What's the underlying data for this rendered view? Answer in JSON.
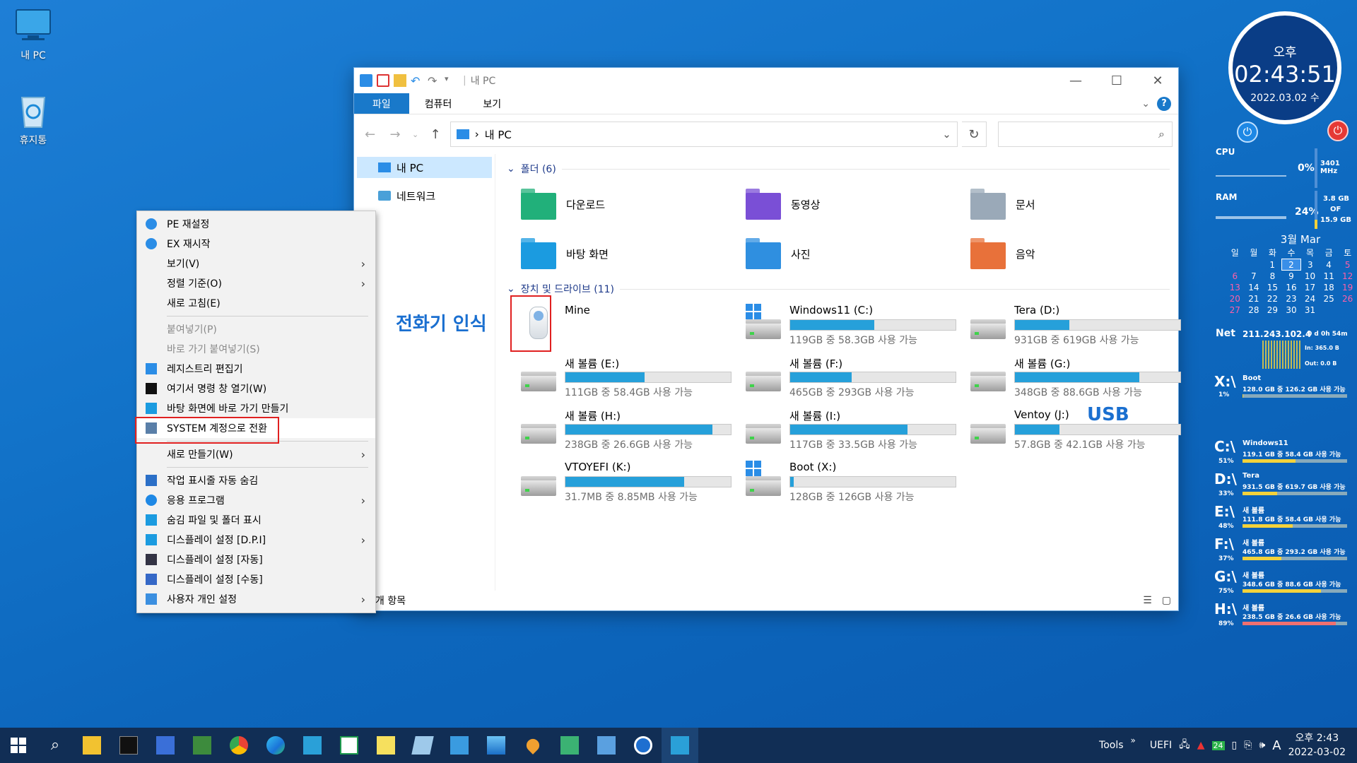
{
  "desktop": {
    "icons": [
      {
        "label": "내 PC"
      },
      {
        "label": "휴지통"
      }
    ]
  },
  "explorer": {
    "title": "내 PC",
    "ribbon_tabs": [
      "파일",
      "컴퓨터",
      "보기"
    ],
    "address": "내 PC",
    "nav": {
      "items": [
        "내 PC",
        "네트워크"
      ]
    },
    "folders_header": "폴더 (6)",
    "folders": [
      {
        "name": "다운로드",
        "icon": "downloads-folder-icon"
      },
      {
        "name": "동영상",
        "icon": "videos-folder-icon"
      },
      {
        "name": "문서",
        "icon": "documents-folder-icon"
      },
      {
        "name": "바탕 화면",
        "icon": "desktop-folder-icon"
      },
      {
        "name": "사진",
        "icon": "pictures-folder-icon"
      },
      {
        "name": "음악",
        "icon": "music-folder-icon"
      }
    ],
    "drives_header": "장치 및 드라이브 (11)",
    "drives": [
      {
        "name": "Mine",
        "type": "phone",
        "free": "",
        "used_fraction": 0
      },
      {
        "name": "Windows11 (C:)",
        "type": "win",
        "free": "119GB 중 58.3GB 사용 가능",
        "used_fraction": 0.51
      },
      {
        "name": "Tera (D:)",
        "type": "hdd",
        "free": "931GB 중 619GB 사용 가능",
        "used_fraction": 0.33
      },
      {
        "name": "새 볼륨 (E:)",
        "type": "hdd",
        "free": "111GB 중 58.4GB 사용 가능",
        "used_fraction": 0.48
      },
      {
        "name": "새 볼륨 (F:)",
        "type": "hdd",
        "free": "465GB 중 293GB 사용 가능",
        "used_fraction": 0.37
      },
      {
        "name": "새 볼륨 (G:)",
        "type": "hdd",
        "free": "348GB 중 88.6GB 사용 가능",
        "used_fraction": 0.75
      },
      {
        "name": "새 볼륨 (H:)",
        "type": "hdd",
        "free": "238GB 중 26.6GB 사용 가능",
        "used_fraction": 0.89
      },
      {
        "name": "새 볼륨 (I:)",
        "type": "hdd",
        "free": "117GB 중 33.5GB 사용 가능",
        "used_fraction": 0.71
      },
      {
        "name": "Ventoy (J:)",
        "type": "hdd",
        "free": "57.8GB 중 42.1GB 사용 가능",
        "used_fraction": 0.27
      },
      {
        "name": "VTOYEFI (K:)",
        "type": "hdd",
        "free": "31.7MB 중 8.85MB 사용 가능",
        "used_fraction": 0.72
      },
      {
        "name": "Boot (X:)",
        "type": "win",
        "free": "128GB 중 126GB 사용 가능",
        "used_fraction": 0.02
      }
    ],
    "status": "개 항목"
  },
  "annotations": {
    "phone": "전화기 인식",
    "usb": "USB"
  },
  "context_menu": {
    "items": [
      {
        "label": "PE 재설정",
        "icon": "refresh-icon",
        "arrow": false,
        "disabled": false
      },
      {
        "label": "EX 재시작",
        "icon": "restart-icon",
        "arrow": false,
        "disabled": false
      },
      {
        "label": "보기(V)",
        "icon": "",
        "arrow": true,
        "disabled": false
      },
      {
        "label": "정렬 기준(O)",
        "icon": "",
        "arrow": true,
        "disabled": false
      },
      {
        "label": "새로 고침(E)",
        "icon": "",
        "arrow": false,
        "disabled": false
      },
      {
        "sep": true
      },
      {
        "label": "붙여넣기(P)",
        "icon": "",
        "arrow": false,
        "disabled": true
      },
      {
        "label": "바로 가기 붙여넣기(S)",
        "icon": "",
        "arrow": false,
        "disabled": true
      },
      {
        "label": "레지스트리 편집기",
        "icon": "registry-icon",
        "arrow": false,
        "disabled": false
      },
      {
        "label": "여기서 명령 창 열기(W)",
        "icon": "cmd-icon",
        "arrow": false,
        "disabled": false
      },
      {
        "label": "바탕 화면에 바로 가기 만들기",
        "icon": "desktop-shortcut-icon",
        "arrow": false,
        "disabled": false
      },
      {
        "label": "SYSTEM 계정으로 전환",
        "icon": "users-icon",
        "arrow": false,
        "disabled": false,
        "highlight": true
      },
      {
        "sep": true
      },
      {
        "label": "새로 만들기(W)",
        "icon": "",
        "arrow": true,
        "disabled": false
      },
      {
        "sep": true
      },
      {
        "label": "작업 표시줄 자동 숨김",
        "icon": "taskbar-icon",
        "arrow": false,
        "disabled": false
      },
      {
        "label": "응용 프로그램",
        "icon": "apps-icon",
        "arrow": true,
        "disabled": false
      },
      {
        "label": "숨김 파일 및 폴더 표시",
        "icon": "hidden-files-icon",
        "arrow": false,
        "disabled": false
      },
      {
        "label": "디스플레이 설정 [D.P.I]",
        "icon": "display-icon",
        "arrow": true,
        "disabled": false
      },
      {
        "label": "디스플레이 설정 [자동]",
        "icon": "display-auto-icon",
        "arrow": false,
        "disabled": false
      },
      {
        "label": "디스플레이 설정 [수동]",
        "icon": "display-manual-icon",
        "arrow": false,
        "disabled": false
      },
      {
        "label": "사용자 개인 설정",
        "icon": "personalize-icon",
        "arrow": true,
        "disabled": false
      }
    ]
  },
  "gadget": {
    "ampm": "오후",
    "time": "02:43:51",
    "date": "2022.03.02 수",
    "cpu": {
      "label": "CPU",
      "value": "0%",
      "freq": "3401 MHz"
    },
    "ram": {
      "label": "RAM",
      "value": "24%",
      "size1": "3.8 GB",
      "of": "OF",
      "size2": "15.9 GB"
    },
    "calendar": {
      "header": "3월 Mar",
      "weekdays": [
        "일",
        "월",
        "화",
        "수",
        "목",
        "금",
        "토"
      ],
      "weeks": [
        [
          "",
          "",
          "1",
          "2",
          "3",
          "4",
          "5"
        ],
        [
          "6",
          "7",
          "8",
          "9",
          "10",
          "11",
          "12"
        ],
        [
          "13",
          "14",
          "15",
          "16",
          "17",
          "18",
          "19"
        ],
        [
          "20",
          "21",
          "22",
          "23",
          "24",
          "25",
          "26"
        ],
        [
          "27",
          "28",
          "29",
          "30",
          "31",
          "",
          ""
        ]
      ]
    },
    "net": {
      "label": "Net",
      "ip": "211.243.102.4",
      "uptime": "0 d 0h 54m",
      "in": "In: 365.0 B",
      "out": "Out: 0.0 B"
    },
    "x_drive": {
      "letter": "X:\\",
      "name": "Boot",
      "size": "128.0 GB 중 126.2 GB 사용 가능",
      "pct": "1%",
      "used_fraction": 0.01
    },
    "drives": [
      {
        "letter": "C:\\",
        "name": "Windows11",
        "size": "119.1 GB 중 58.4 GB 사용 가능",
        "pct": "51%",
        "used_fraction": 0.51,
        "color": "#f3d23b"
      },
      {
        "letter": "D:\\",
        "name": "Tera",
        "size": "931.5 GB 중 619.7 GB 사용 가능",
        "pct": "33%",
        "used_fraction": 0.33,
        "color": "#f3d23b"
      },
      {
        "letter": "E:\\",
        "name": "새 볼륨",
        "size": "111.8 GB 중 58.4 GB 사용 가능",
        "pct": "48%",
        "used_fraction": 0.48,
        "color": "#f3d23b"
      },
      {
        "letter": "F:\\",
        "name": "새 볼륨",
        "size": "465.8 GB 중 293.2 GB 사용 가능",
        "pct": "37%",
        "used_fraction": 0.37,
        "color": "#f3d23b"
      },
      {
        "letter": "G:\\",
        "name": "새 볼륨",
        "size": "348.6 GB 중 88.6 GB 사용 가능",
        "pct": "75%",
        "used_fraction": 0.75,
        "color": "#f3d23b"
      },
      {
        "letter": "H:\\",
        "name": "새 볼륨",
        "size": "238.5 GB 중 26.6 GB 사용 가능",
        "pct": "89%",
        "used_fraction": 0.89,
        "color": "#f07070"
      }
    ]
  },
  "taskbar": {
    "tools_label": "Tools",
    "uefi_label": "UEFI",
    "badge": "24",
    "ime": "A",
    "clock_ampm_time": "오후 2:43",
    "clock_date": "2022-03-02"
  }
}
